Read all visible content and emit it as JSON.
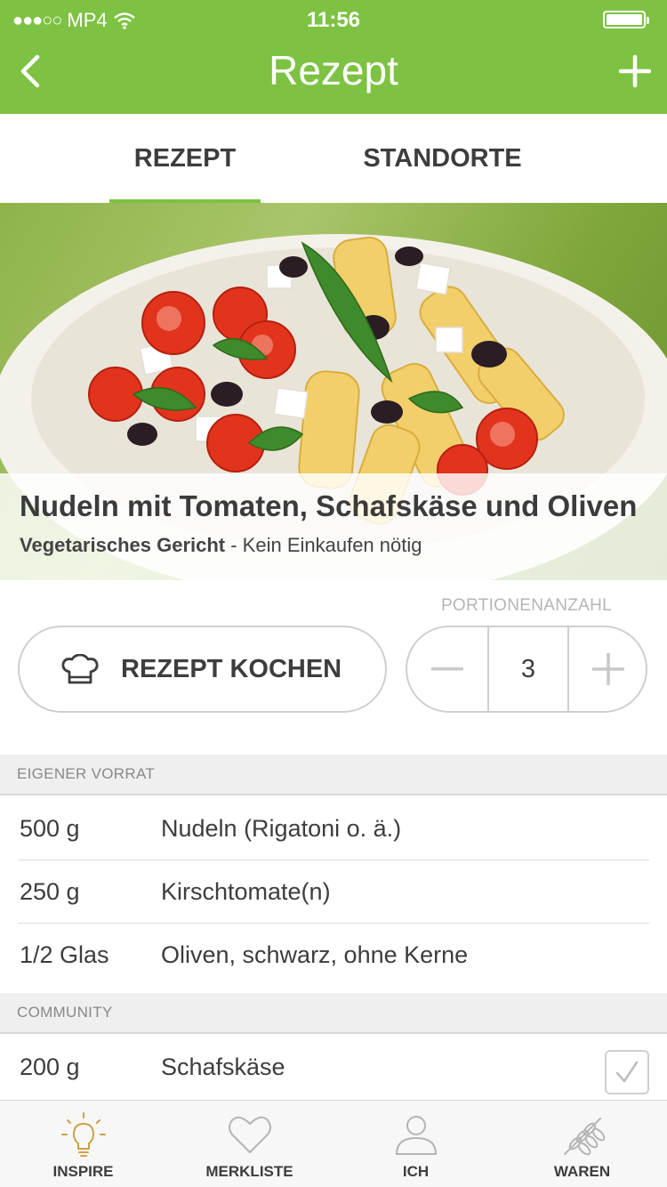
{
  "status_bar": {
    "carrier": "MP4",
    "time": "11:56"
  },
  "nav": {
    "title": "Rezept",
    "back_icon": "chevron-left-icon",
    "add_icon": "plus-icon"
  },
  "tabs": [
    {
      "label": "REZEPT",
      "active": true
    },
    {
      "label": "STANDORTE",
      "active": false
    }
  ],
  "recipe": {
    "title": "Nudeln mit Tomaten, Schafskäse und Oliven",
    "category": "Vegetarisches Gericht",
    "note": " - Kein Einkaufen nötig"
  },
  "actions": {
    "cook_label": "REZEPT KOCHEN",
    "cook_icon": "chef-hat-icon",
    "portion_label": "PORTIONENANZAHL",
    "portions": "3"
  },
  "sections": [
    {
      "title": "EIGENER VORRAT",
      "items": [
        {
          "amount": "500 g",
          "name": "Nudeln (Rigatoni o. ä.)"
        },
        {
          "amount": "250 g",
          "name": "Kirschtomate(n)"
        },
        {
          "amount": "1/2 Glas",
          "name": "Oliven, schwarz, ohne Kerne"
        }
      ]
    },
    {
      "title": "COMMUNITY",
      "items": [
        {
          "amount": "200 g",
          "name": "Schafskäse",
          "checked": true
        }
      ]
    }
  ],
  "tabbar": [
    {
      "label": "INSPIRE",
      "icon": "lightbulb-icon",
      "active": true
    },
    {
      "label": "MERKLISTE",
      "icon": "heart-icon",
      "active": false
    },
    {
      "label": "ICH",
      "icon": "user-icon",
      "active": false
    },
    {
      "label": "WAREN",
      "icon": "wheat-icon",
      "active": false
    }
  ],
  "colors": {
    "brand_green": "#7dc242",
    "inspire_icon": "#c9a24a"
  }
}
